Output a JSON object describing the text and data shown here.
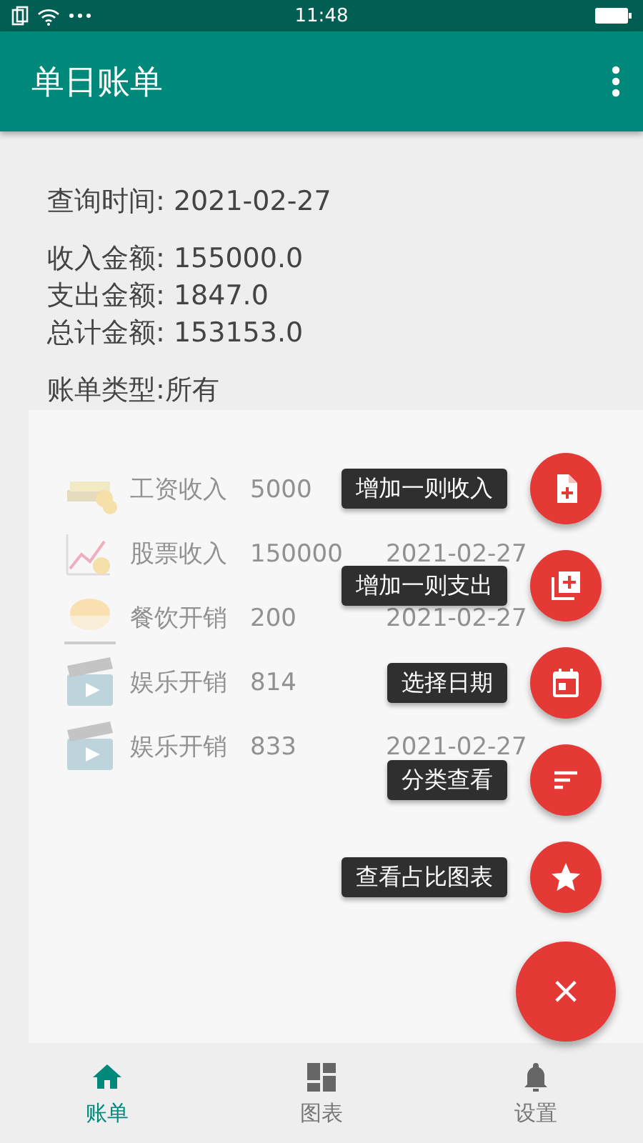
{
  "status_bar": {
    "time": "11:48"
  },
  "app_bar": {
    "title": "单日账单"
  },
  "summary": {
    "query_date": "查询时间: 2021-02-27",
    "income": "收入金额: 155000.0",
    "expense": "支出金额: 1847.0",
    "total": "总计金额: 153153.0",
    "bill_type": "账单类型:所有"
  },
  "bills": [
    {
      "kind": "money",
      "name": "工资收入",
      "amount": "5000"
    },
    {
      "kind": "stock",
      "name": "股票收入",
      "amount": "150000",
      "date": "2021-02-27"
    },
    {
      "kind": "food",
      "name": "餐饮开销",
      "amount": "200",
      "date": "2021-02-27"
    },
    {
      "kind": "movie",
      "name": "娱乐开销",
      "amount": "814"
    },
    {
      "kind": "movie",
      "name": "娱乐开销",
      "amount": "833",
      "date": "2021-02-27"
    }
  ],
  "fab_menu": [
    {
      "kind": "add-file",
      "label": "增加一则收入"
    },
    {
      "kind": "add-layers",
      "label": "增加一则支出"
    },
    {
      "kind": "calendar",
      "label": "选择日期"
    },
    {
      "kind": "sort",
      "label": "分类查看"
    },
    {
      "kind": "star",
      "label": "查看占比图表"
    }
  ],
  "fab_close": "×",
  "bottom_nav": [
    {
      "kind": "home",
      "label": "账单",
      "selected": true
    },
    {
      "kind": "dashboard",
      "label": "图表",
      "selected": false
    },
    {
      "kind": "bell",
      "label": "设置",
      "selected": false
    }
  ]
}
